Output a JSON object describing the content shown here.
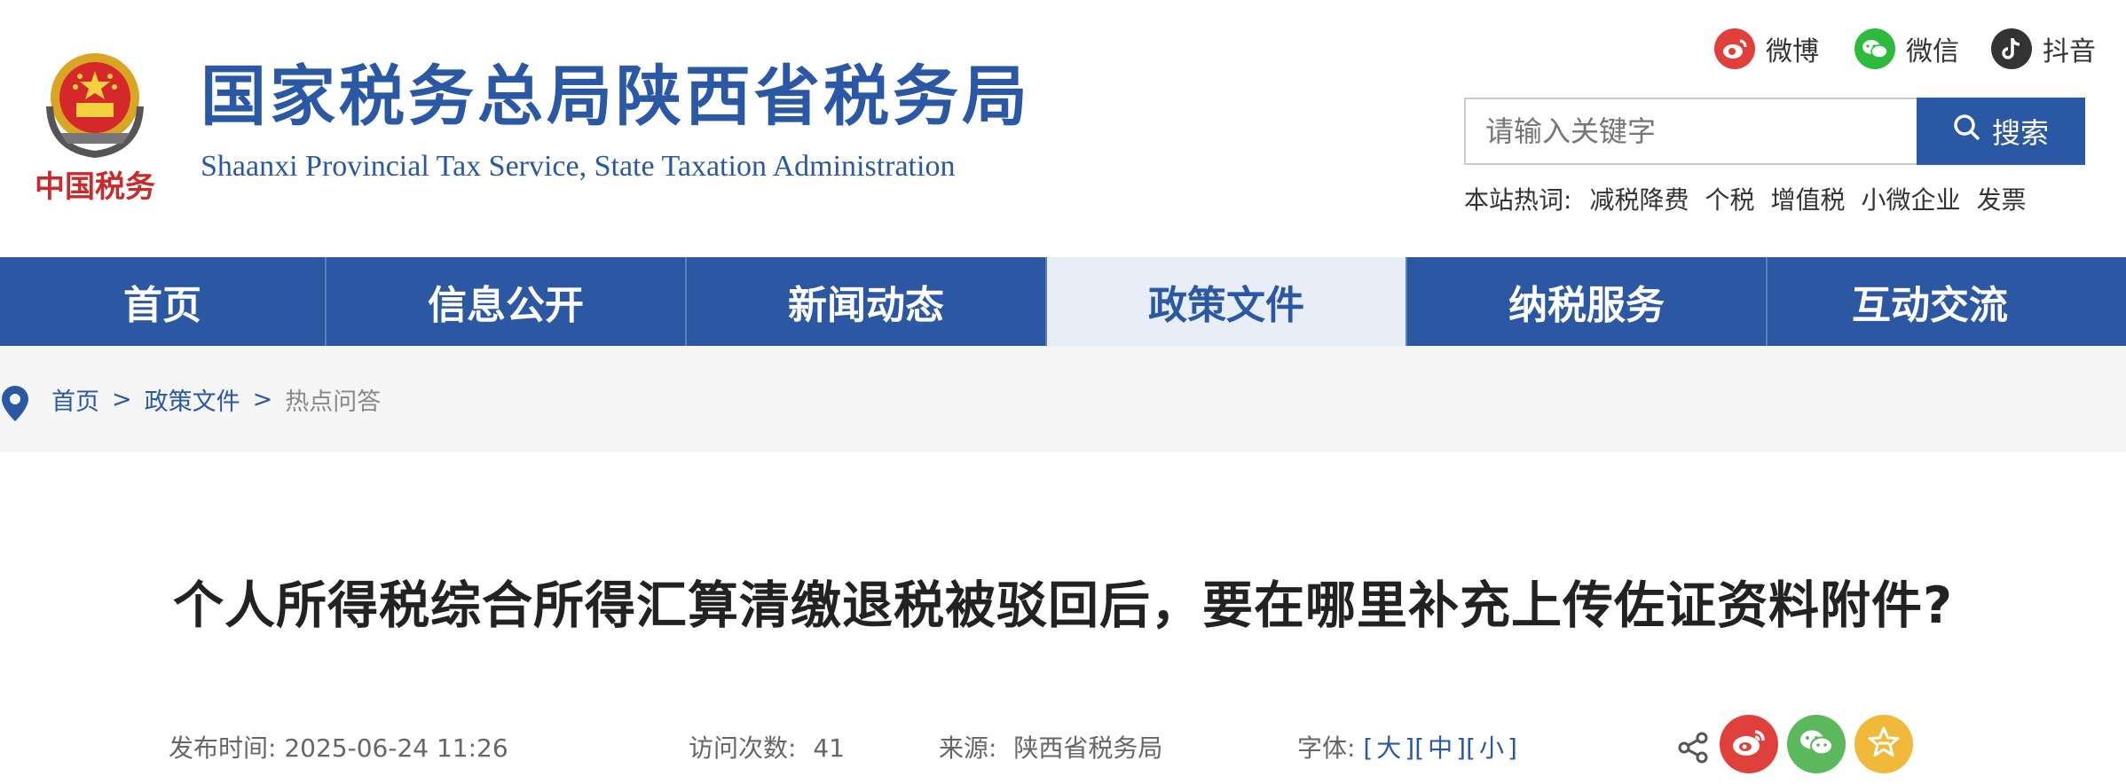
{
  "header": {
    "emblem_text": "中国税务",
    "title": "国家税务总局陕西省税务局",
    "subtitle": "Shaanxi Provincial Tax Service, State Taxation Administration"
  },
  "social": [
    {
      "label": "微博",
      "icon": "weibo-icon",
      "color": "#e0403b"
    },
    {
      "label": "微信",
      "icon": "wechat-icon",
      "color": "#2dba3d"
    },
    {
      "label": "抖音",
      "icon": "douyin-icon",
      "color": "#333333"
    }
  ],
  "search": {
    "placeholder": "请输入关键字",
    "button_label": "搜索"
  },
  "hot_words": {
    "label": "本站热词:",
    "items": [
      "减税降费",
      "个税",
      "增值税",
      "小微企业",
      "发票"
    ]
  },
  "nav": {
    "items": [
      "首页",
      "信息公开",
      "新闻动态",
      "政策文件",
      "纳税服务",
      "互动交流"
    ],
    "active": "政策文件"
  },
  "breadcrumb": {
    "items": [
      "首页",
      "政策文件"
    ],
    "separator": ">",
    "current": "热点问答"
  },
  "article": {
    "title": "个人所得税综合所得汇算清缴退税被驳回后，要在哪里补充上传佐证资料附件?",
    "publish_label": "发布时间:",
    "publish_time": "2025-06-24 11:26",
    "visits_label": "访问次数:",
    "visits": "41",
    "source_label": "来源:",
    "source": "陕西省税务局",
    "font_label": "字体:",
    "font_sizes": [
      "大",
      "中",
      "小"
    ]
  },
  "share": {
    "buttons": [
      {
        "name": "weibo",
        "color": "#e0403b"
      },
      {
        "name": "wechat",
        "color": "#5cb85c"
      },
      {
        "name": "favorite",
        "color": "#f0b93a"
      }
    ]
  },
  "colors": {
    "brand_blue": "#2a58a4",
    "nav_bg": "#2b57a3",
    "nav_active_bg": "#e8eef8",
    "crumb_bg": "#f5f5f5"
  }
}
